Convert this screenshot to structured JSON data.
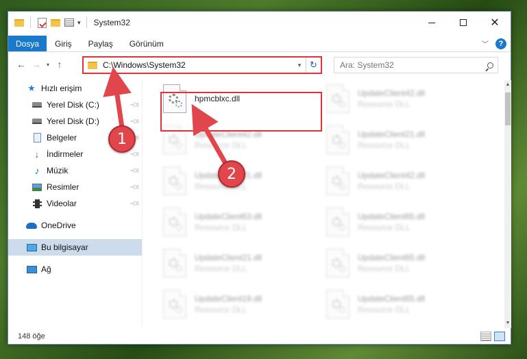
{
  "window": {
    "title": "System32"
  },
  "ribbon": {
    "tabs": [
      "Dosya",
      "Giriş",
      "Paylaş",
      "Görünüm"
    ],
    "help": "?"
  },
  "nav": {
    "address": "C:\\Windows\\System32",
    "search_placeholder": "Ara: System32"
  },
  "sidebar": {
    "items": [
      {
        "label": "Hızlı erişim",
        "icon": "star-icon"
      },
      {
        "label": "Yerel Disk (C:)",
        "icon": "drive-icon",
        "pinned": true
      },
      {
        "label": "Yerel Disk (D:)",
        "icon": "drive-icon",
        "pinned": true
      },
      {
        "label": "Belgeler",
        "icon": "documents-icon",
        "pinned": true
      },
      {
        "label": "İndirmeler",
        "icon": "downloads-icon",
        "pinned": true
      },
      {
        "label": "Müzik",
        "icon": "music-icon",
        "pinned": true
      },
      {
        "label": "Resimler",
        "icon": "pictures-icon",
        "pinned": true
      },
      {
        "label": "Videolar",
        "icon": "videos-icon",
        "pinned": true
      },
      {
        "label": "OneDrive",
        "icon": "onedrive-icon"
      },
      {
        "label": "Bu bilgisayar",
        "icon": "this-pc-icon",
        "selected": true
      },
      {
        "label": "Ağ",
        "icon": "network-icon"
      }
    ]
  },
  "files": {
    "featured": {
      "name": "hpmcblxc.dll",
      "type": ""
    },
    "left": [
      {
        "name": "UpdateClient42.dll",
        "type": "Resource DLL"
      },
      {
        "name": "UpdateClient21.dll",
        "type": "Resource DLL"
      },
      {
        "name": "UpdateClient63.dll",
        "type": "Resource DLL"
      },
      {
        "name": "UpdateClient21.dll",
        "type": "Resource DLL"
      },
      {
        "name": "UpdateClient19.dll",
        "type": "Resource DLL"
      }
    ],
    "right": [
      {
        "name": "UpdateClient42.dll",
        "type": "Resource DLL"
      },
      {
        "name": "UpdateClient21.dll",
        "type": "Resource DLL"
      },
      {
        "name": "UpdateClient42.dll",
        "type": "Resource DLL"
      },
      {
        "name": "UpdateClient65.dll",
        "type": "Resource DLL"
      },
      {
        "name": "UpdateClient65.dll",
        "type": "Resource DLL"
      },
      {
        "name": "UpdateClient65.dll",
        "type": "Resource DLL"
      }
    ]
  },
  "status": {
    "item_count": "148 öğe"
  },
  "annotations": {
    "step1": "1",
    "step2": "2",
    "color": "#e0464c"
  }
}
